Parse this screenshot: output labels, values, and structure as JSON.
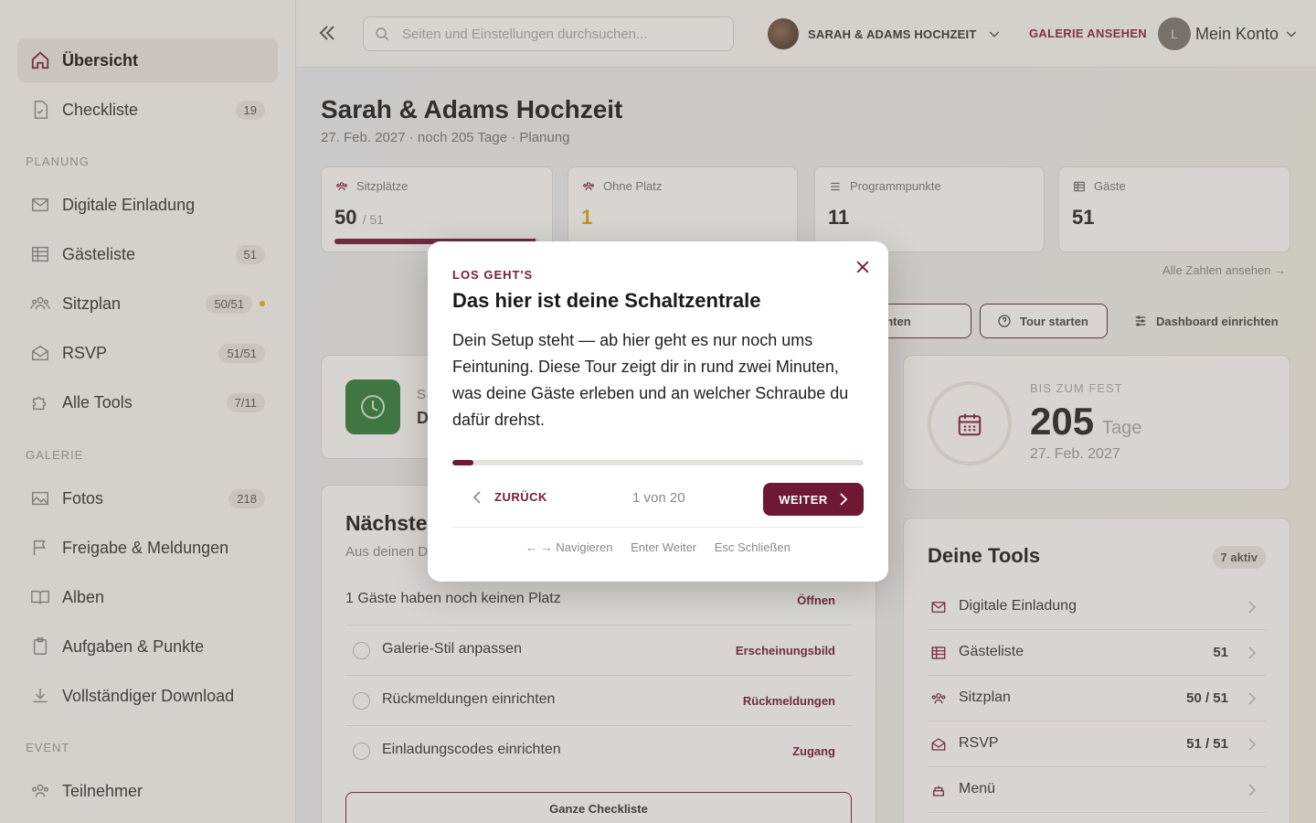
{
  "sidebar": {
    "items": [
      {
        "label": "Übersicht"
      },
      {
        "label": "Checkliste",
        "badge": "19"
      },
      {
        "label": "Digitale Einladung"
      },
      {
        "label": "Gästeliste",
        "badge": "51"
      },
      {
        "label": "Sitzplan",
        "badge": "50/51"
      },
      {
        "label": "RSVP",
        "badge": "51/51"
      },
      {
        "label": "Alle Tools",
        "badge": "7/11"
      },
      {
        "label": "Fotos",
        "badge": "218"
      },
      {
        "label": "Freigabe & Meldungen"
      },
      {
        "label": "Alben"
      },
      {
        "label": "Aufgaben & Punkte"
      },
      {
        "label": "Vollständiger Download"
      },
      {
        "label": "Teilnehmer"
      }
    ],
    "sections": {
      "planung": "PLANUNG",
      "galerie": "GALERIE",
      "event": "EVENT"
    }
  },
  "topbar": {
    "search_placeholder": "Seiten und Einstellungen durchsuchen...",
    "project_name": "SARAH & ADAMS HOCHZEIT",
    "gallery_link": "GALERIE ANSEHEN",
    "account_initial": "L",
    "account_label": "Mein Konto"
  },
  "page": {
    "title": "Sarah & Adams Hochzeit",
    "subtitle": "27. Feb. 2027 · noch 205 Tage · Planung"
  },
  "stats": [
    {
      "label": "Sitzplätze",
      "value": "50",
      "total": "/ 51",
      "progress": 0.98
    },
    {
      "label": "Ohne Platz",
      "value": "1"
    },
    {
      "label": "Programmpunkte",
      "value": "11"
    },
    {
      "label": "Gäste",
      "value": "51"
    }
  ],
  "all_numbers_link": "Alle Zahlen ansehen",
  "actions": {
    "setup_partial": "g einrichten",
    "tour": "Tour starten",
    "dashboard": "Dashboard einrichten"
  },
  "countdown": {
    "label": "BIS ZUM FEST",
    "value": "205",
    "unit": "Tage",
    "date": "27. Feb. 2027"
  },
  "status_card": {
    "line1": "S",
    "line2": "D"
  },
  "next_steps": {
    "title": "Nächste",
    "subtitle": "Aus deinen D",
    "tasks": [
      {
        "label": "1 Gäste haben noch keinen Platz",
        "tag": "Öffnen"
      },
      {
        "label": "Galerie-Stil anpassen",
        "tag": "Erscheinungsbild"
      },
      {
        "label": "Rückmeldungen einrichten",
        "tag": "Rückmeldungen"
      },
      {
        "label": "Einladungscodes einrichten",
        "tag": "Zugang"
      }
    ],
    "full_button": "Ganze Checkliste"
  },
  "tools": {
    "title": "Deine Tools",
    "badge": "7 aktiv",
    "items": [
      {
        "label": "Digitale Einladung",
        "value": ""
      },
      {
        "label": "Gästeliste",
        "value": "51"
      },
      {
        "label": "Sitzplan",
        "value": "50 / 51"
      },
      {
        "label": "RSVP",
        "value": "51 / 51"
      },
      {
        "label": "Menü",
        "value": ""
      }
    ]
  },
  "modal": {
    "eyebrow": "LOS GEHT'S",
    "title": "Das hier ist deine Schaltzentrale",
    "body": "Dein Setup steht — ab hier geht es nur noch ums Feintuning. Diese Tour zeigt dir in rund zwei Minuten, was deine Gäste erleben und an welcher Schraube du dafür drehst.",
    "progress": 0.05,
    "back": "ZURÜCK",
    "step": "1 von 20",
    "next": "WEITER",
    "hints": [
      "← → Navigieren",
      "Enter Weiter",
      "Esc Schließen"
    ]
  },
  "colors": {
    "accent": "#6e1834",
    "warning": "#e0b21d",
    "success": "#2e7d3a"
  }
}
